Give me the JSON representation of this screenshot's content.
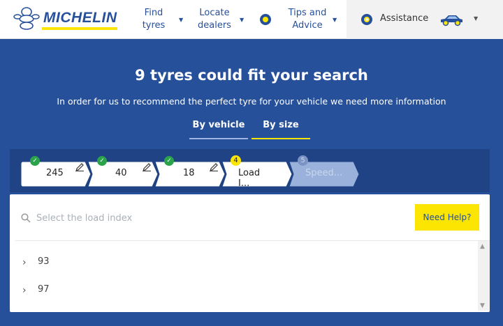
{
  "header": {
    "brand": "MICHELIN",
    "nav": [
      {
        "label_1": "Find",
        "label_2": "tyres"
      },
      {
        "label_1": "Locate",
        "label_2": "dealers"
      },
      {
        "label_1": "Tips and",
        "label_2": "Advice"
      }
    ],
    "assistance_label": "Assistance"
  },
  "hero": {
    "title": "9 tyres could fit your search",
    "subtitle": "In order for us to recommend the perfect tyre for your vehicle we need more information",
    "tabs": [
      {
        "label": "By vehicle"
      },
      {
        "label": "By size"
      }
    ]
  },
  "steps": [
    {
      "value": "245",
      "done": true
    },
    {
      "value": "40",
      "done": true
    },
    {
      "value": "18",
      "done": true
    },
    {
      "number": "4",
      "value": "Load I..."
    },
    {
      "number": "5",
      "value": "Speed..."
    }
  ],
  "panel": {
    "search_placeholder": "Select the load index",
    "help_label": "Need Help?",
    "options": [
      {
        "label": "93"
      },
      {
        "label": "97"
      }
    ]
  },
  "colors": {
    "brand_blue": "#27509b",
    "brand_yellow": "#fce500",
    "check_green": "#2aa34a"
  }
}
